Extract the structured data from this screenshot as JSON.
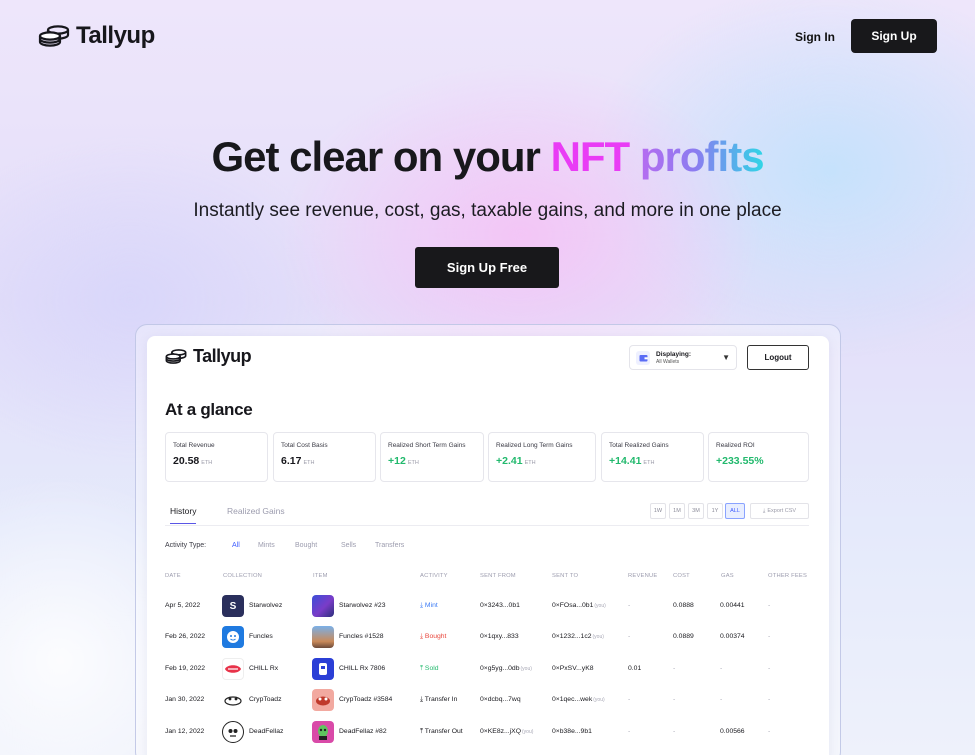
{
  "nav": {
    "logo": "Tallyup",
    "sign_in": "Sign In",
    "sign_up": "Sign Up"
  },
  "hero": {
    "title_prefix": "Get clear on your ",
    "title_nft": "NFT",
    "title_profits": "profits",
    "subtitle": "Instantly see revenue, cost, gas, taxable gains, and more in one place",
    "cta": "Sign Up Free"
  },
  "colors": {
    "accent_magenta": "#e93cf5",
    "accent_cyan": "#2fd6e6",
    "gain_green": "#22b96d",
    "loss_red": "#e8463c",
    "link_blue": "#3d5bff",
    "dark_button": "#18181b"
  },
  "app": {
    "logo": "Tallyup",
    "displaying_label": "Displaying:",
    "displaying_value": "All Wallets",
    "logout": "Logout",
    "heading": "At a glance",
    "stats": [
      {
        "label": "Total Revenue",
        "value": "20.58",
        "unit": "ETH"
      },
      {
        "label": "Total Cost Basis",
        "value": "6.17",
        "unit": "ETH"
      },
      {
        "label": "Realized Short Term Gains",
        "value": "+12",
        "unit": "ETH"
      },
      {
        "label": "Realized Long Term Gains",
        "value": "+2.41",
        "unit": "ETH"
      },
      {
        "label": "Total Realized Gains",
        "value": "+14.41",
        "unit": "ETH"
      },
      {
        "label": "Realized ROI",
        "value": "+233.55%",
        "unit": ""
      }
    ],
    "tabs": [
      "History",
      "Realized Gains"
    ],
    "ranges": [
      "1W",
      "1M",
      "3M",
      "1Y",
      "ALL"
    ],
    "selected_range": "ALL",
    "export": "Export CSV",
    "activity_type_label": "Activity Type:",
    "filters": [
      "All",
      "Mints",
      "Bought",
      "Sells",
      "Transfers"
    ],
    "selected_filter": "All",
    "columns": [
      "DATE",
      "COLLECTION",
      "ITEM",
      "ACTIVITY",
      "SENT FROM",
      "SENT TO",
      "REVENUE",
      "COST",
      "GAS",
      "OTHER FEES"
    ],
    "you_tag": "(you)",
    "rows": [
      {
        "date": "Apr 5, 2022",
        "collection": "Starwolvez",
        "item": "Starwolvez #23",
        "activity": "Mint",
        "sent_from": "0×3243...0b1",
        "sent_to": "0×FOsa...0b1",
        "revenue": "-",
        "cost": "0.0888",
        "gas": "0.00441",
        "other_fees": "-"
      },
      {
        "date": "Feb 26, 2022",
        "collection": "Funcles",
        "item": "Funcles #1528",
        "activity": "Bought",
        "sent_from": "0×1qxy...833",
        "sent_to": "0×1232...1c2",
        "revenue": "-",
        "cost": "0.0889",
        "gas": "0.00374",
        "other_fees": "-"
      },
      {
        "date": "Feb 19, 2022",
        "collection": "CHILL Rx",
        "item": "CHILL Rx 7806",
        "activity": "Sold",
        "sent_from": "0×g5yg...0db",
        "sent_to": "0×PxSV...yK8",
        "revenue": "0.01",
        "cost": "-",
        "gas": "-",
        "other_fees": "-"
      },
      {
        "date": "Jan 30, 2022",
        "collection": "CrypToadz",
        "item": "CrypToadz #3584",
        "activity": "Transfer In",
        "sent_from": "0×dcbq...7wq",
        "sent_to": "0×1qec...wek",
        "revenue": "-",
        "cost": "-",
        "gas": "-",
        "other_fees": "-"
      },
      {
        "date": "Jan 12, 2022",
        "collection": "DeadFellaz",
        "item": "DeadFellaz #82",
        "activity": "Transfer Out",
        "sent_from": "0×KE8z...jXQ",
        "sent_to": "0×b38e...9b1",
        "revenue": "-",
        "cost": "-",
        "gas": "0.00566",
        "other_fees": "-"
      }
    ]
  }
}
